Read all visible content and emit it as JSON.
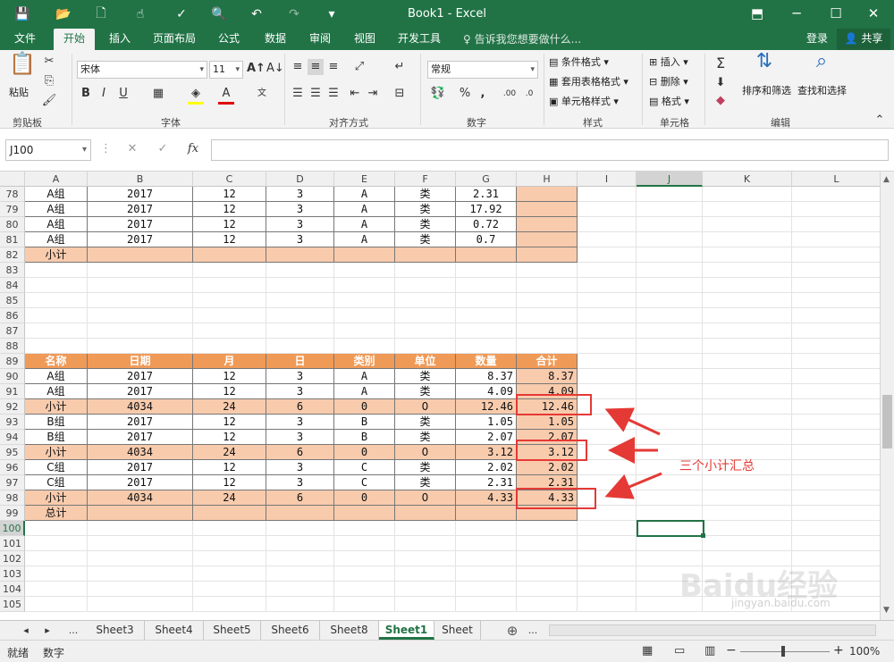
{
  "window": {
    "title": "Book1 - Excel",
    "minimize": "─",
    "maximize": "☐",
    "close": "✕",
    "ribbon_display": "⬒"
  },
  "quick_access": {
    "save": "💾",
    "open": "📂",
    "new": "🗋",
    "touch": "☝",
    "spell": "✓",
    "preview": "🔍",
    "undo": "↶",
    "redo": "↷",
    "customize": "▾"
  },
  "tabs": [
    "文件",
    "开始",
    "插入",
    "页面布局",
    "公式",
    "数据",
    "审阅",
    "视图",
    "开发工具"
  ],
  "tell_me": "告诉我您想要做什么...",
  "login": "登录",
  "share": "共享",
  "ribbon": {
    "clipboard": {
      "label": "剪贴板",
      "paste": "粘贴"
    },
    "font": {
      "label": "字体",
      "name": "宋体",
      "size": "11",
      "bold": "B",
      "italic": "I",
      "underline": "U",
      "grow": "A↑",
      "shrink": "A↓"
    },
    "alignment": {
      "label": "对齐方式"
    },
    "number": {
      "label": "数字",
      "format": "常规",
      "percent": "%",
      "comma": ","
    },
    "styles": {
      "label": "样式",
      "conditional": "条件格式",
      "table": "套用表格格式",
      "cell": "单元格样式"
    },
    "cells": {
      "label": "单元格",
      "insert": "插入",
      "delete": "删除",
      "format": "格式"
    },
    "editing": {
      "label": "编辑",
      "sort": "排序和筛选",
      "find": "查找和选择"
    }
  },
  "formula_bar": {
    "name_box": "J100",
    "fx": "fx",
    "cancel": "✕",
    "enter": "✓",
    "value": ""
  },
  "columns": [
    "A",
    "B",
    "C",
    "D",
    "E",
    "F",
    "G",
    "H",
    "I",
    "J",
    "K",
    "L"
  ],
  "selected_column": "J",
  "rows": [
    {
      "n": "78",
      "cells": [
        "A组",
        "2017",
        "12",
        "3",
        "A",
        "类",
        "2.31",
        ""
      ]
    },
    {
      "n": "79",
      "cells": [
        "A组",
        "2017",
        "12",
        "3",
        "A",
        "类",
        "17.92",
        ""
      ]
    },
    {
      "n": "80",
      "cells": [
        "A组",
        "2017",
        "12",
        "3",
        "A",
        "类",
        "0.72",
        ""
      ]
    },
    {
      "n": "81",
      "cells": [
        "A组",
        "2017",
        "12",
        "3",
        "A",
        "类",
        "0.7",
        ""
      ]
    },
    {
      "n": "82",
      "cells": [
        "小计",
        "",
        "",
        "",
        "",
        "",
        "",
        ""
      ]
    },
    {
      "n": "83",
      "cells": []
    },
    {
      "n": "84",
      "cells": []
    },
    {
      "n": "85",
      "cells": []
    },
    {
      "n": "86",
      "cells": []
    },
    {
      "n": "87",
      "cells": []
    },
    {
      "n": "88",
      "cells": []
    },
    {
      "n": "89",
      "cells": [
        "名称",
        "日期",
        "月",
        "日",
        "类别",
        "单位",
        "数量",
        "合计"
      ]
    },
    {
      "n": "90",
      "cells": [
        "A组",
        "2017",
        "12",
        "3",
        "A",
        "类",
        "8.37",
        "8.37"
      ]
    },
    {
      "n": "91",
      "cells": [
        "A组",
        "2017",
        "12",
        "3",
        "A",
        "类",
        "4.09",
        "4.09"
      ]
    },
    {
      "n": "92",
      "cells": [
        "小计",
        "4034",
        "24",
        "6",
        "0",
        "0",
        "12.46",
        "12.46"
      ]
    },
    {
      "n": "93",
      "cells": [
        "B组",
        "2017",
        "12",
        "3",
        "B",
        "类",
        "1.05",
        "1.05"
      ]
    },
    {
      "n": "94",
      "cells": [
        "B组",
        "2017",
        "12",
        "3",
        "B",
        "类",
        "2.07",
        "2.07"
      ]
    },
    {
      "n": "95",
      "cells": [
        "小计",
        "4034",
        "24",
        "6",
        "0",
        "0",
        "3.12",
        "3.12"
      ]
    },
    {
      "n": "96",
      "cells": [
        "C组",
        "2017",
        "12",
        "3",
        "C",
        "类",
        "2.02",
        "2.02"
      ]
    },
    {
      "n": "97",
      "cells": [
        "C组",
        "2017",
        "12",
        "3",
        "C",
        "类",
        "2.31",
        "2.31"
      ]
    },
    {
      "n": "98",
      "cells": [
        "小计",
        "4034",
        "24",
        "6",
        "0",
        "0",
        "4.33",
        "4.33"
      ]
    },
    {
      "n": "99",
      "cells": [
        "总计",
        "",
        "",
        "",
        "",
        "",
        "",
        ""
      ]
    },
    {
      "n": "100",
      "cells": []
    },
    {
      "n": "101",
      "cells": []
    },
    {
      "n": "102",
      "cells": []
    },
    {
      "n": "103",
      "cells": []
    },
    {
      "n": "104",
      "cells": []
    },
    {
      "n": "105",
      "cells": []
    }
  ],
  "selected_row": "100",
  "annotation": "三个小计汇总",
  "sheet_tabs": [
    "Sheet3",
    "Sheet4",
    "Sheet5",
    "Sheet6",
    "Sheet8",
    "Sheet1",
    "Sheet"
  ],
  "active_sheet": "Sheet1",
  "sheet_nav": {
    "prev": "◂",
    "next": "▸",
    "more": "...",
    "more_right": "...",
    "add": "⊕"
  },
  "status": {
    "ready": "就绪",
    "numlock": "数字",
    "zoom": "100%",
    "minus": "−",
    "plus": "+"
  },
  "watermark": {
    "logo": "Baidu经验",
    "url": "jingyan.baidu.com"
  },
  "colors": {
    "excel_green": "#217346",
    "header_orange": "#f09a57",
    "cell_tan": "#f8cbad",
    "annotation_red": "#e53935"
  }
}
